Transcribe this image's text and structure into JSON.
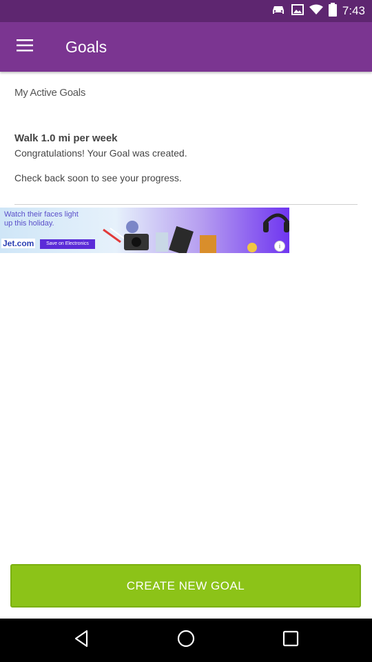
{
  "status_bar": {
    "time": "7:43"
  },
  "app_bar": {
    "title": "Goals"
  },
  "section": {
    "title": "My Active Goals"
  },
  "goal": {
    "title": "Walk 1.0 mi per week",
    "line1": "Congratulations! Your Goal was created.",
    "line2": "Check back soon to see your progress."
  },
  "ad": {
    "headline": "Watch their faces light up this holiday.",
    "logo": "Jet.com",
    "cta": "Save on Electronics"
  },
  "actions": {
    "create_label": "CREATE NEW GOAL"
  },
  "colors": {
    "app_bar": "#7b3591",
    "status_bar": "#5e2670",
    "button": "#8cc318"
  },
  "icons": [
    "hamburger-menu-icon",
    "wifi-icon",
    "battery-icon",
    "car-icon",
    "gallery-icon",
    "back-icon",
    "home-icon",
    "recents-icon",
    "info-icon"
  ]
}
